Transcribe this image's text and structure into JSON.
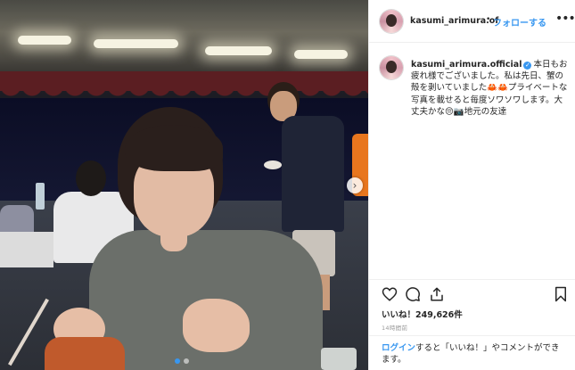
{
  "post": {
    "username": "kasumi_arimura.official",
    "username_short": "kasumi_arimura.of",
    "separator": "•",
    "follow_label": "フォローする",
    "more_label": "•••",
    "caption_text": "本日もお疲れ様でございました。私は先日、蟹の殻を剥いていました🦀🦀プライベートな写真を載せると毎度ソワソワします。大丈夫かな😔📷地元の友達",
    "likes": "いいね！249,626件",
    "time_ago": "14時間前",
    "login_link": "ログイン",
    "login_suffix": "すると「いいね！」やコメントができます。",
    "accent_color": "#3897f0"
  },
  "icons": {
    "like": "heart-icon",
    "comment": "comment-icon",
    "share": "share-icon",
    "save": "bookmark-icon",
    "next": "chevron-right-icon",
    "verified": "verified-badge-icon"
  },
  "carousel": {
    "slides": 2,
    "active_slide": 1
  }
}
